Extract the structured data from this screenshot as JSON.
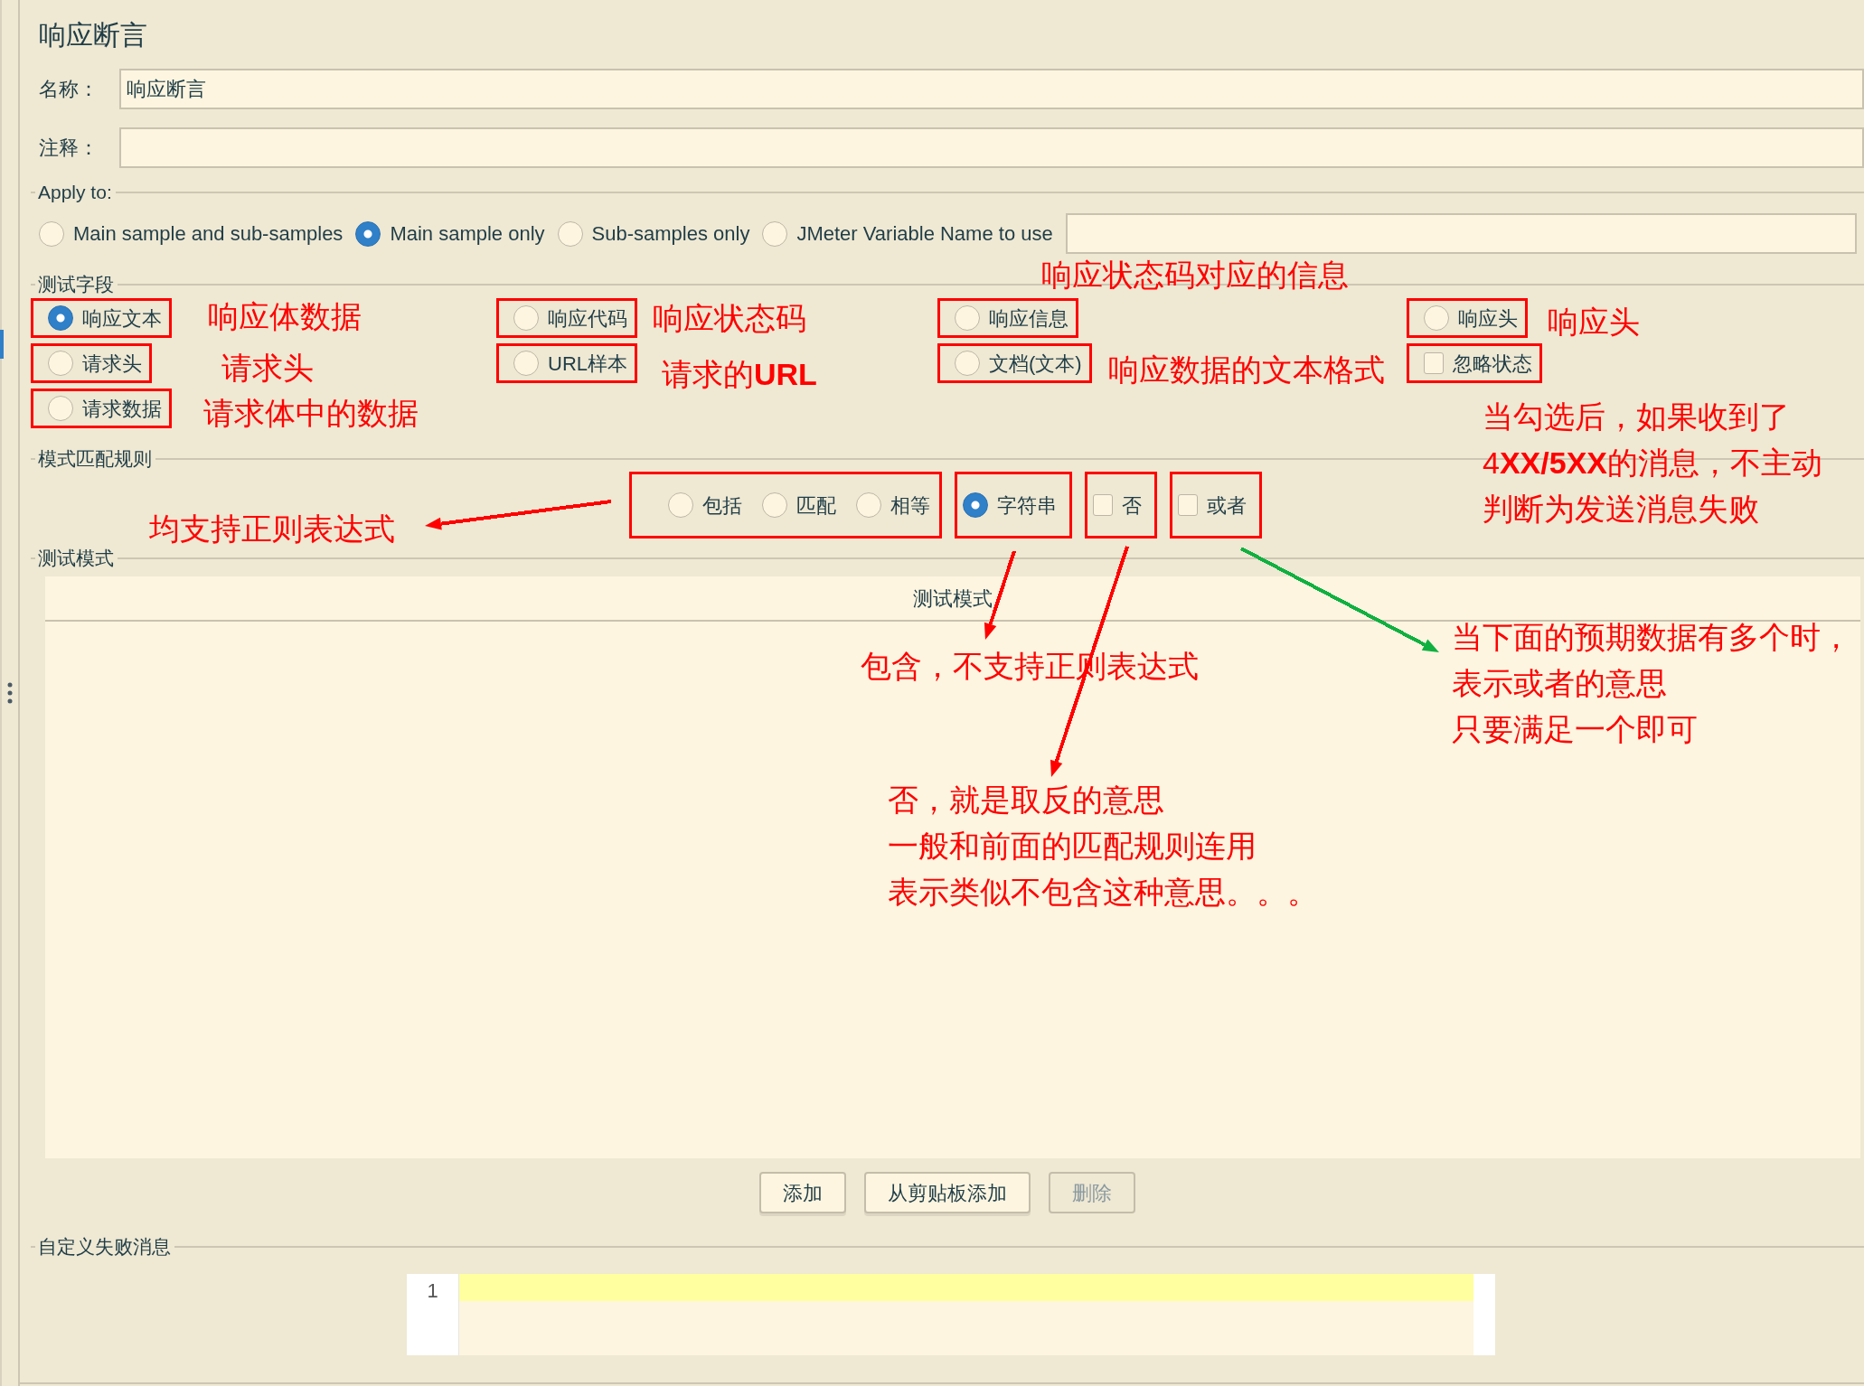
{
  "panel_title": "响应断言",
  "fields": [
    {
      "label": "名称：",
      "value": "响应断言"
    },
    {
      "label": "注释："
    }
  ],
  "apply_to": {
    "legend": "Apply to:",
    "options": [
      {
        "label": "Main sample and sub-samples",
        "selected": false
      },
      {
        "label": "Main sample only",
        "selected": true
      },
      {
        "label": "Sub-samples only",
        "selected": false
      },
      {
        "label": "JMeter Variable Name to use",
        "selected": false
      }
    ]
  },
  "test_field": {
    "legend": "测试字段",
    "columns": [
      [
        {
          "kind": "radio",
          "label": "响应文本",
          "selected": true,
          "highlighted": true
        },
        {
          "kind": "radio",
          "label": "请求头",
          "selected": false,
          "highlighted": true
        },
        {
          "kind": "radio",
          "label": "请求数据",
          "selected": false,
          "highlighted": true
        }
      ],
      [
        {
          "kind": "radio",
          "label": "响应代码",
          "selected": false,
          "highlighted": true
        },
        {
          "kind": "radio",
          "label": "URL样本",
          "selected": false,
          "highlighted": true
        }
      ],
      [
        {
          "kind": "radio",
          "label": "响应信息",
          "selected": false,
          "highlighted": true
        },
        {
          "kind": "radio",
          "label": "文档(文本)",
          "selected": false,
          "highlighted": true
        }
      ],
      [
        {
          "kind": "radio",
          "label": "响应头",
          "selected": false,
          "highlighted": true
        },
        {
          "kind": "checkbox",
          "label": "忽略状态",
          "checked": false,
          "highlighted": true
        }
      ]
    ]
  },
  "pattern_rules": {
    "legend": "模式匹配规则",
    "groups": [
      {
        "highlighted": true,
        "items": [
          {
            "kind": "radio",
            "label": "包括",
            "selected": false
          },
          {
            "kind": "radio",
            "label": "匹配",
            "selected": false
          },
          {
            "kind": "radio",
            "label": "相等",
            "selected": false
          }
        ]
      },
      {
        "highlighted": true,
        "items": [
          {
            "kind": "radio",
            "label": "字符串",
            "selected": true
          }
        ]
      },
      {
        "highlighted": true,
        "items": [
          {
            "kind": "checkbox",
            "label": "否",
            "checked": false
          }
        ]
      },
      {
        "highlighted": true,
        "items": [
          {
            "kind": "checkbox",
            "label": "或者",
            "checked": false
          }
        ]
      }
    ]
  },
  "test_patterns": {
    "legend": "测试模式",
    "columns": [
      "测试模式"
    ]
  },
  "buttons": [
    {
      "label": "添加",
      "disabled": false
    },
    {
      "label": "从剪贴板添加",
      "disabled": false
    },
    {
      "label": "删除",
      "disabled": true
    }
  ],
  "failure_message": {
    "legend": "自定义失败消息",
    "line_numbers": [
      "1"
    ]
  },
  "annotations": [
    {
      "lines": [
        "响应体数据"
      ]
    },
    {
      "lines": [
        "请求头"
      ]
    },
    {
      "lines": [
        "请求体中的数据"
      ]
    },
    {
      "lines": [
        "响应状态码"
      ]
    },
    {
      "lines": [
        "请求的**URL**"
      ]
    },
    {
      "lines": [
        "响应状态码对应的信息"
      ]
    },
    {
      "lines": [
        "响应数据的文本格式"
      ]
    },
    {
      "lines": [
        "响应头"
      ]
    },
    {
      "lines": [
        "当勾选后，如果收到了",
        "4**XX/5XX**的消息，不主动",
        "判断为发送消息失败"
      ]
    },
    {
      "lines": [
        "均支持正则表达式"
      ]
    },
    {
      "lines": [
        "包含，不支持正则表达式"
      ]
    },
    {
      "lines": [
        "否，就是取反的意思",
        "一般和前面的匹配规则连用",
        "表示类似不包含这种意思。。。"
      ]
    },
    {
      "lines": [
        "当下面的预期数据有多个时，",
        "表示或者的意思",
        "只要满足一个即可"
      ]
    }
  ],
  "arrows": [
    {
      "color": "#ff0000"
    },
    {
      "color": "#ff0000"
    },
    {
      "color": "#ff0000"
    },
    {
      "color": "#10b040"
    }
  ]
}
